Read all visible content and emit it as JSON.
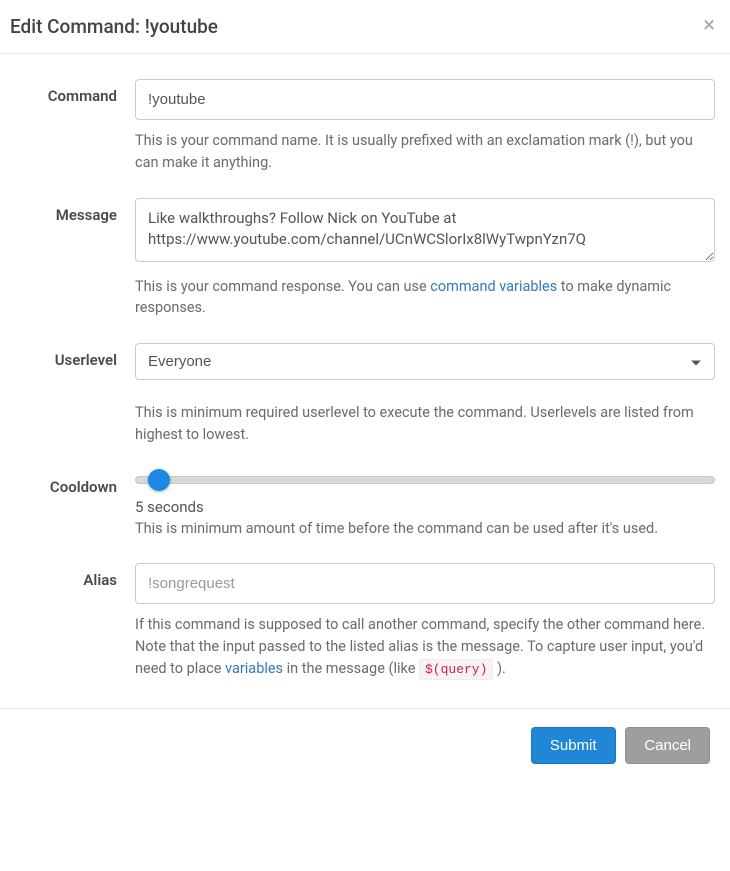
{
  "header": {
    "title": "Edit Command: !youtube"
  },
  "command": {
    "label": "Command",
    "value": "!youtube",
    "help": "This is your command name. It is usually prefixed with an exclamation mark (!), but you can make it anything."
  },
  "message": {
    "label": "Message",
    "value": "Like walkthroughs? Follow Nick on YouTube at https://www.youtube.com/channel/UCnWCSlorIx8lWyTwpnYzn7Q",
    "help_before": "This is your command response. You can use ",
    "help_link": "command variables",
    "help_after": " to make dynamic responses."
  },
  "userlevel": {
    "label": "Userlevel",
    "selected": "Everyone",
    "help": "This is minimum required userlevel to execute the command. Userlevels are listed from highest to lowest."
  },
  "cooldown": {
    "label": "Cooldown",
    "value_text": "5 seconds",
    "slider_percent": 4,
    "help": "This is minimum amount of time before the command can be used after it's used."
  },
  "alias": {
    "label": "Alias",
    "placeholder": "!songrequest",
    "help_part1": "If this command is supposed to call another command, specify the other command here. Note that the input passed to the listed alias is the message. To capture user input, you'd need to place ",
    "help_link": "variables",
    "help_part2": " in the message (like ",
    "code": "$(query)",
    "help_part3": " )."
  },
  "footer": {
    "submit": "Submit",
    "cancel": "Cancel"
  }
}
